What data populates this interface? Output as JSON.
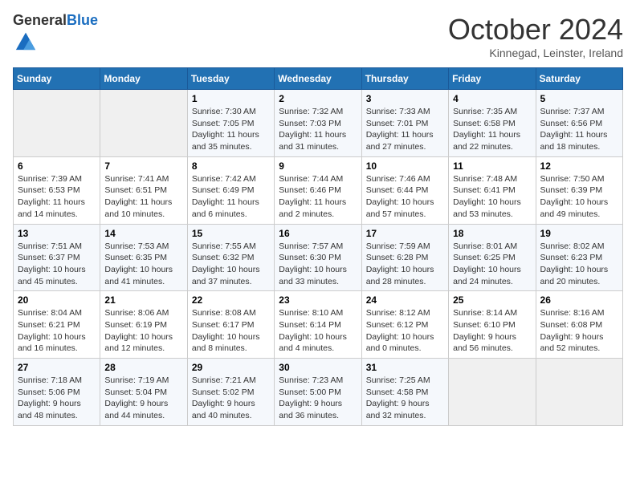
{
  "header": {
    "logo_general": "General",
    "logo_blue": "Blue",
    "month_title": "October 2024",
    "location": "Kinnegad, Leinster, Ireland"
  },
  "weekdays": [
    "Sunday",
    "Monday",
    "Tuesday",
    "Wednesday",
    "Thursday",
    "Friday",
    "Saturday"
  ],
  "weeks": [
    [
      {
        "day": "",
        "info": ""
      },
      {
        "day": "",
        "info": ""
      },
      {
        "day": "1",
        "info": "Sunrise: 7:30 AM\nSunset: 7:05 PM\nDaylight: 11 hours\nand 35 minutes."
      },
      {
        "day": "2",
        "info": "Sunrise: 7:32 AM\nSunset: 7:03 PM\nDaylight: 11 hours\nand 31 minutes."
      },
      {
        "day": "3",
        "info": "Sunrise: 7:33 AM\nSunset: 7:01 PM\nDaylight: 11 hours\nand 27 minutes."
      },
      {
        "day": "4",
        "info": "Sunrise: 7:35 AM\nSunset: 6:58 PM\nDaylight: 11 hours\nand 22 minutes."
      },
      {
        "day": "5",
        "info": "Sunrise: 7:37 AM\nSunset: 6:56 PM\nDaylight: 11 hours\nand 18 minutes."
      }
    ],
    [
      {
        "day": "6",
        "info": "Sunrise: 7:39 AM\nSunset: 6:53 PM\nDaylight: 11 hours\nand 14 minutes."
      },
      {
        "day": "7",
        "info": "Sunrise: 7:41 AM\nSunset: 6:51 PM\nDaylight: 11 hours\nand 10 minutes."
      },
      {
        "day": "8",
        "info": "Sunrise: 7:42 AM\nSunset: 6:49 PM\nDaylight: 11 hours\nand 6 minutes."
      },
      {
        "day": "9",
        "info": "Sunrise: 7:44 AM\nSunset: 6:46 PM\nDaylight: 11 hours\nand 2 minutes."
      },
      {
        "day": "10",
        "info": "Sunrise: 7:46 AM\nSunset: 6:44 PM\nDaylight: 10 hours\nand 57 minutes."
      },
      {
        "day": "11",
        "info": "Sunrise: 7:48 AM\nSunset: 6:41 PM\nDaylight: 10 hours\nand 53 minutes."
      },
      {
        "day": "12",
        "info": "Sunrise: 7:50 AM\nSunset: 6:39 PM\nDaylight: 10 hours\nand 49 minutes."
      }
    ],
    [
      {
        "day": "13",
        "info": "Sunrise: 7:51 AM\nSunset: 6:37 PM\nDaylight: 10 hours\nand 45 minutes."
      },
      {
        "day": "14",
        "info": "Sunrise: 7:53 AM\nSunset: 6:35 PM\nDaylight: 10 hours\nand 41 minutes."
      },
      {
        "day": "15",
        "info": "Sunrise: 7:55 AM\nSunset: 6:32 PM\nDaylight: 10 hours\nand 37 minutes."
      },
      {
        "day": "16",
        "info": "Sunrise: 7:57 AM\nSunset: 6:30 PM\nDaylight: 10 hours\nand 33 minutes."
      },
      {
        "day": "17",
        "info": "Sunrise: 7:59 AM\nSunset: 6:28 PM\nDaylight: 10 hours\nand 28 minutes."
      },
      {
        "day": "18",
        "info": "Sunrise: 8:01 AM\nSunset: 6:25 PM\nDaylight: 10 hours\nand 24 minutes."
      },
      {
        "day": "19",
        "info": "Sunrise: 8:02 AM\nSunset: 6:23 PM\nDaylight: 10 hours\nand 20 minutes."
      }
    ],
    [
      {
        "day": "20",
        "info": "Sunrise: 8:04 AM\nSunset: 6:21 PM\nDaylight: 10 hours\nand 16 minutes."
      },
      {
        "day": "21",
        "info": "Sunrise: 8:06 AM\nSunset: 6:19 PM\nDaylight: 10 hours\nand 12 minutes."
      },
      {
        "day": "22",
        "info": "Sunrise: 8:08 AM\nSunset: 6:17 PM\nDaylight: 10 hours\nand 8 minutes."
      },
      {
        "day": "23",
        "info": "Sunrise: 8:10 AM\nSunset: 6:14 PM\nDaylight: 10 hours\nand 4 minutes."
      },
      {
        "day": "24",
        "info": "Sunrise: 8:12 AM\nSunset: 6:12 PM\nDaylight: 10 hours\nand 0 minutes."
      },
      {
        "day": "25",
        "info": "Sunrise: 8:14 AM\nSunset: 6:10 PM\nDaylight: 9 hours\nand 56 minutes."
      },
      {
        "day": "26",
        "info": "Sunrise: 8:16 AM\nSunset: 6:08 PM\nDaylight: 9 hours\nand 52 minutes."
      }
    ],
    [
      {
        "day": "27",
        "info": "Sunrise: 7:18 AM\nSunset: 5:06 PM\nDaylight: 9 hours\nand 48 minutes."
      },
      {
        "day": "28",
        "info": "Sunrise: 7:19 AM\nSunset: 5:04 PM\nDaylight: 9 hours\nand 44 minutes."
      },
      {
        "day": "29",
        "info": "Sunrise: 7:21 AM\nSunset: 5:02 PM\nDaylight: 9 hours\nand 40 minutes."
      },
      {
        "day": "30",
        "info": "Sunrise: 7:23 AM\nSunset: 5:00 PM\nDaylight: 9 hours\nand 36 minutes."
      },
      {
        "day": "31",
        "info": "Sunrise: 7:25 AM\nSunset: 4:58 PM\nDaylight: 9 hours\nand 32 minutes."
      },
      {
        "day": "",
        "info": ""
      },
      {
        "day": "",
        "info": ""
      }
    ]
  ]
}
